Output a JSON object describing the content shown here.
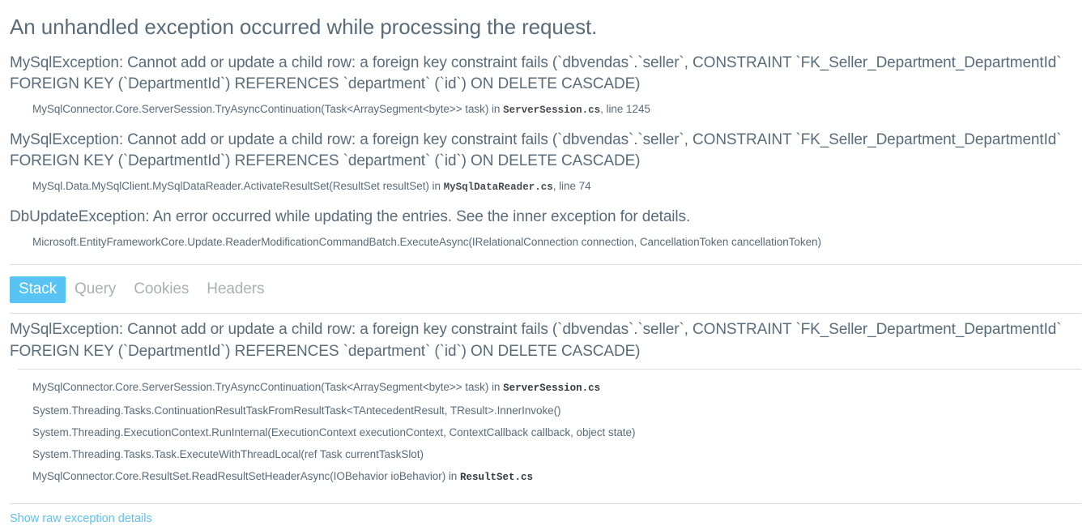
{
  "page": {
    "title": "An unhandled exception occurred while processing the request.",
    "raw_details_link": "Show raw exception details"
  },
  "colors": {
    "text": "#5a6b7a",
    "accent": "#58c4f4",
    "link": "#5ec1ef",
    "muted_tab": "#aab0b5",
    "rule": "#dddddd"
  },
  "exceptions": [
    {
      "title": "MySqlException: Cannot add or update a child row: a foreign key constraint fails (`dbvendas`.`seller`, CONSTRAINT `FK_Seller_Department_DepartmentId` FOREIGN KEY (`DepartmentId`) REFERENCES `department` (`id`) ON DELETE CASCADE)",
      "frame_text": "MySqlConnector.Core.ServerSession.TryAsyncContinuation(Task<ArraySegment<byte>> task) in",
      "frame_file": "ServerSession.cs",
      "frame_line": ", line 1245"
    },
    {
      "title": "MySqlException: Cannot add or update a child row: a foreign key constraint fails (`dbvendas`.`seller`, CONSTRAINT `FK_Seller_Department_DepartmentId` FOREIGN KEY (`DepartmentId`) REFERENCES `department` (`id`) ON DELETE CASCADE)",
      "frame_text": "MySql.Data.MySqlClient.MySqlDataReader.ActivateResultSet(ResultSet resultSet) in",
      "frame_file": "MySqlDataReader.cs",
      "frame_line": ", line 74"
    },
    {
      "title": "DbUpdateException: An error occurred while updating the entries. See the inner exception for details.",
      "frame_text": "Microsoft.EntityFrameworkCore.Update.ReaderModificationCommandBatch.ExecuteAsync(IRelationalConnection connection, CancellationToken cancellationToken)",
      "frame_file": "",
      "frame_line": ""
    }
  ],
  "tabs": [
    {
      "label": "Stack",
      "active": true
    },
    {
      "label": "Query",
      "active": false
    },
    {
      "label": "Cookies",
      "active": false
    },
    {
      "label": "Headers",
      "active": false
    }
  ],
  "stack_panel": {
    "heading": "MySqlException: Cannot add or update a child row: a foreign key constraint fails (`dbvendas`.`seller`, CONSTRAINT `FK_Seller_Department_DepartmentId` FOREIGN KEY (`DepartmentId`) REFERENCES `department` (`id`) ON DELETE CASCADE)",
    "frames": [
      {
        "text": "MySqlConnector.Core.ServerSession.TryAsyncContinuation(Task<ArraySegment<byte>> task) in",
        "file": "ServerSession.cs"
      },
      {
        "text": "System.Threading.Tasks.ContinuationResultTaskFromResultTask<TAntecedentResult, TResult>.InnerInvoke()",
        "file": ""
      },
      {
        "text": "System.Threading.ExecutionContext.RunInternal(ExecutionContext executionContext, ContextCallback callback, object state)",
        "file": ""
      },
      {
        "text": "System.Threading.Tasks.Task.ExecuteWithThreadLocal(ref Task currentTaskSlot)",
        "file": ""
      },
      {
        "text": "MySqlConnector.Core.ResultSet.ReadResultSetHeaderAsync(IOBehavior ioBehavior) in",
        "file": "ResultSet.cs"
      }
    ]
  }
}
